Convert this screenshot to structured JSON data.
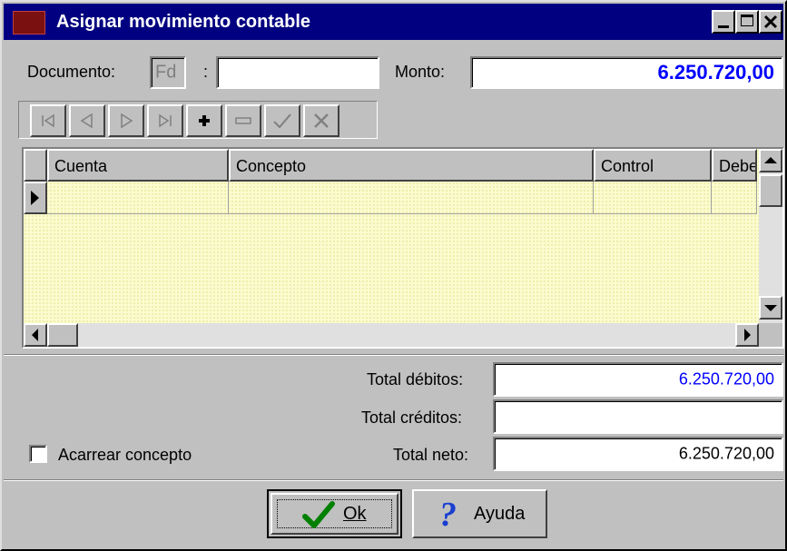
{
  "window": {
    "title": "Asignar movimiento contable",
    "controls": {
      "minimize": "_",
      "maximize": "□",
      "close": "X"
    }
  },
  "header": {
    "documento_label": "Documento:",
    "documento_prefix": "Fd",
    "documento_separator": ":",
    "documento_value": "",
    "monto_label": "Monto:",
    "monto_value": "6.250.720,00"
  },
  "navigator": {
    "buttons": [
      "first",
      "prior",
      "next",
      "last",
      "insert",
      "delete",
      "post",
      "cancel"
    ]
  },
  "grid": {
    "columns": [
      "Cuenta",
      "Concepto",
      "Control",
      "Debe"
    ],
    "rows": [
      [
        "",
        "",
        "",
        ""
      ]
    ]
  },
  "totals": {
    "debitos_label": "Total débitos:",
    "debitos_value": "6.250.720,00",
    "creditos_label": "Total créditos:",
    "creditos_value": "",
    "neto_label": "Total neto:",
    "neto_value": "6.250.720,00"
  },
  "options": {
    "acarrear_label": "Acarrear concepto",
    "acarrear_checked": false
  },
  "buttons": {
    "ok_label": "Ok",
    "ayuda_label": "Ayuda"
  },
  "colors": {
    "title_bg": "#000080",
    "accent_blue": "#0000ff",
    "grid_bg": "#fbfbcf",
    "ok_check": "#008000"
  }
}
